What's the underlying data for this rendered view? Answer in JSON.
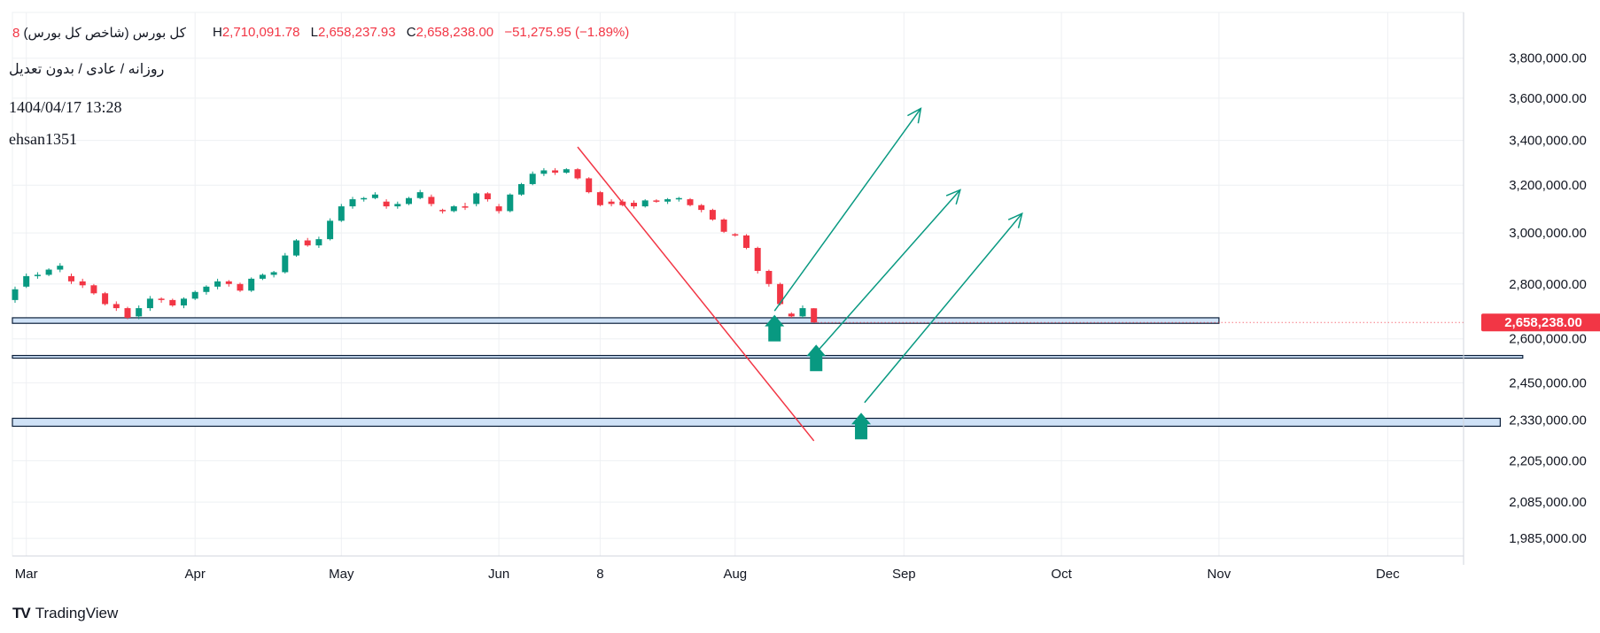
{
  "header": {
    "symbol": "کل بورس (شاخص کل بورس)",
    "suffix": "8",
    "high_label": "H",
    "high": "2,710,091.78",
    "low_label": "L",
    "low": "2,658,237.93",
    "close_label": "C",
    "close": "2,658,238.00",
    "change": "−51,275.95 (−1.89%)",
    "subtitle": "روزانه / عادی / بدون تعدیل",
    "timestamp": "1404/04/17 13:28",
    "author": "ehsan1351"
  },
  "brand": {
    "logo_text": "TV",
    "name": "TradingView"
  },
  "colors": {
    "up": "#089981",
    "down": "#f23645",
    "trendline": "#f23645",
    "projection": "#089981",
    "zone_fill": "#cfe2f7",
    "zone_border": "#0b1f3a",
    "grid": "#eef0f3",
    "price_tag": "#f23645"
  },
  "chart_data": {
    "type": "candlestick",
    "title": "کل بورس (شاخص کل بورس)",
    "y_scale": "log",
    "ylim": [
      1950000,
      3900000
    ],
    "grid": true,
    "y_ticks": [
      "3,800,000.00",
      "3,600,000.00",
      "3,400,000.00",
      "3,200,000.00",
      "3,000,000.00",
      "2,800,000.00",
      "2,600,000.00",
      "2,450,000.00",
      "2,330,000.00",
      "2,205,000.00",
      "2,085,000.00",
      "1,985,000.00"
    ],
    "y_tick_values": [
      3800000,
      3600000,
      3400000,
      3200000,
      3000000,
      2800000,
      2600000,
      2450000,
      2330000,
      2205000,
      2085000,
      1985000
    ],
    "x_ticks": [
      {
        "label": "Mar",
        "bar": 1
      },
      {
        "label": "Apr",
        "bar": 16
      },
      {
        "label": "May",
        "bar": 29
      },
      {
        "label": "Jun",
        "bar": 43
      },
      {
        "label": "8",
        "bar": 52
      },
      {
        "label": "Aug",
        "bar": 64
      },
      {
        "label": "Sep",
        "bar": 79
      },
      {
        "label": "Oct",
        "bar": 93
      },
      {
        "label": "Nov",
        "bar": 107
      },
      {
        "label": "Dec",
        "bar": 122
      }
    ],
    "last_price": 2658238,
    "last_price_label": "2,658,238.00",
    "candles": [
      {
        "o": 2740000,
        "h": 2790000,
        "l": 2730000,
        "c": 2780000
      },
      {
        "o": 2790000,
        "h": 2840000,
        "l": 2785000,
        "c": 2830000
      },
      {
        "o": 2830000,
        "h": 2845000,
        "l": 2820000,
        "c": 2835000
      },
      {
        "o": 2835000,
        "h": 2860000,
        "l": 2830000,
        "c": 2855000
      },
      {
        "o": 2855000,
        "h": 2880000,
        "l": 2845000,
        "c": 2870000
      },
      {
        "o": 2830000,
        "h": 2840000,
        "l": 2800000,
        "c": 2810000
      },
      {
        "o": 2810000,
        "h": 2820000,
        "l": 2785000,
        "c": 2795000
      },
      {
        "o": 2795000,
        "h": 2800000,
        "l": 2760000,
        "c": 2765000
      },
      {
        "o": 2765000,
        "h": 2770000,
        "l": 2720000,
        "c": 2725000
      },
      {
        "o": 2725000,
        "h": 2735000,
        "l": 2700000,
        "c": 2710000
      },
      {
        "o": 2710000,
        "h": 2715000,
        "l": 2670000,
        "c": 2675000
      },
      {
        "o": 2680000,
        "h": 2720000,
        "l": 2670000,
        "c": 2710000
      },
      {
        "o": 2710000,
        "h": 2755000,
        "l": 2700000,
        "c": 2745000
      },
      {
        "o": 2745000,
        "h": 2750000,
        "l": 2730000,
        "c": 2740000
      },
      {
        "o": 2740000,
        "h": 2745000,
        "l": 2715000,
        "c": 2720000
      },
      {
        "o": 2720000,
        "h": 2750000,
        "l": 2710000,
        "c": 2745000
      },
      {
        "o": 2745000,
        "h": 2775000,
        "l": 2740000,
        "c": 2770000
      },
      {
        "o": 2770000,
        "h": 2795000,
        "l": 2760000,
        "c": 2790000
      },
      {
        "o": 2790000,
        "h": 2820000,
        "l": 2780000,
        "c": 2810000
      },
      {
        "o": 2810000,
        "h": 2815000,
        "l": 2790000,
        "c": 2800000
      },
      {
        "o": 2800000,
        "h": 2805000,
        "l": 2770000,
        "c": 2775000
      },
      {
        "o": 2775000,
        "h": 2825000,
        "l": 2770000,
        "c": 2820000
      },
      {
        "o": 2820000,
        "h": 2840000,
        "l": 2815000,
        "c": 2835000
      },
      {
        "o": 2835000,
        "h": 2850000,
        "l": 2825000,
        "c": 2845000
      },
      {
        "o": 2845000,
        "h": 2920000,
        "l": 2840000,
        "c": 2910000
      },
      {
        "o": 2910000,
        "h": 2975000,
        "l": 2905000,
        "c": 2970000
      },
      {
        "o": 2970000,
        "h": 2980000,
        "l": 2945000,
        "c": 2950000
      },
      {
        "o": 2950000,
        "h": 2985000,
        "l": 2940000,
        "c": 2975000
      },
      {
        "o": 2975000,
        "h": 3060000,
        "l": 2970000,
        "c": 3050000
      },
      {
        "o": 3050000,
        "h": 3120000,
        "l": 3045000,
        "c": 3110000
      },
      {
        "o": 3110000,
        "h": 3150000,
        "l": 3100000,
        "c": 3140000
      },
      {
        "o": 3140000,
        "h": 3150000,
        "l": 3130000,
        "c": 3145000
      },
      {
        "o": 3145000,
        "h": 3170000,
        "l": 3140000,
        "c": 3160000
      },
      {
        "o": 3130000,
        "h": 3140000,
        "l": 3100000,
        "c": 3110000
      },
      {
        "o": 3110000,
        "h": 3130000,
        "l": 3100000,
        "c": 3120000
      },
      {
        "o": 3120000,
        "h": 3150000,
        "l": 3115000,
        "c": 3145000
      },
      {
        "o": 3145000,
        "h": 3180000,
        "l": 3140000,
        "c": 3170000
      },
      {
        "o": 3150000,
        "h": 3160000,
        "l": 3110000,
        "c": 3120000
      },
      {
        "o": 3095000,
        "h": 3100000,
        "l": 3080000,
        "c": 3090000
      },
      {
        "o": 3090000,
        "h": 3115000,
        "l": 3085000,
        "c": 3110000
      },
      {
        "o": 3110000,
        "h": 3125000,
        "l": 3095000,
        "c": 3105000
      },
      {
        "o": 3120000,
        "h": 3170000,
        "l": 3110000,
        "c": 3165000
      },
      {
        "o": 3165000,
        "h": 3170000,
        "l": 3130000,
        "c": 3140000
      },
      {
        "o": 3110000,
        "h": 3120000,
        "l": 3080000,
        "c": 3090000
      },
      {
        "o": 3090000,
        "h": 3165000,
        "l": 3085000,
        "c": 3160000
      },
      {
        "o": 3160000,
        "h": 3210000,
        "l": 3155000,
        "c": 3205000
      },
      {
        "o": 3205000,
        "h": 3260000,
        "l": 3200000,
        "c": 3250000
      },
      {
        "o": 3250000,
        "h": 3275000,
        "l": 3240000,
        "c": 3265000
      },
      {
        "o": 3265000,
        "h": 3275000,
        "l": 3245000,
        "c": 3255000
      },
      {
        "o": 3255000,
        "h": 3275000,
        "l": 3250000,
        "c": 3270000
      },
      {
        "o": 3270000,
        "h": 3275000,
        "l": 3225000,
        "c": 3230000
      },
      {
        "o": 3230000,
        "h": 3235000,
        "l": 3165000,
        "c": 3170000
      },
      {
        "o": 3170000,
        "h": 3175000,
        "l": 3110000,
        "c": 3115000
      },
      {
        "o": 3130000,
        "h": 3140000,
        "l": 3110000,
        "c": 3120000
      },
      {
        "o": 3130000,
        "h": 3140000,
        "l": 3110000,
        "c": 3115000
      },
      {
        "o": 3125000,
        "h": 3135000,
        "l": 3100000,
        "c": 3110000
      },
      {
        "o": 3110000,
        "h": 3140000,
        "l": 3105000,
        "c": 3135000
      },
      {
        "o": 3135000,
        "h": 3140000,
        "l": 3125000,
        "c": 3130000
      },
      {
        "o": 3130000,
        "h": 3145000,
        "l": 3120000,
        "c": 3140000
      },
      {
        "o": 3140000,
        "h": 3150000,
        "l": 3130000,
        "c": 3145000
      },
      {
        "o": 3140000,
        "h": 3145000,
        "l": 3110000,
        "c": 3115000
      },
      {
        "o": 3115000,
        "h": 3120000,
        "l": 3085000,
        "c": 3095000
      },
      {
        "o": 3095000,
        "h": 3100000,
        "l": 3050000,
        "c": 3055000
      },
      {
        "o": 3055000,
        "h": 3060000,
        "l": 3000000,
        "c": 3005000
      },
      {
        "o": 2995000,
        "h": 3000000,
        "l": 2985000,
        "c": 2990000
      },
      {
        "o": 2990000,
        "h": 2995000,
        "l": 2935000,
        "c": 2940000
      },
      {
        "o": 2940000,
        "h": 2945000,
        "l": 2840000,
        "c": 2850000
      },
      {
        "o": 2850000,
        "h": 2855000,
        "l": 2790000,
        "c": 2800000
      },
      {
        "o": 2800000,
        "h": 2805000,
        "l": 2720000,
        "c": 2725000
      },
      {
        "o": 2690000,
        "h": 2695000,
        "l": 2675000,
        "c": 2680000
      },
      {
        "o": 2680000,
        "h": 2720000,
        "l": 2675000,
        "c": 2710000
      },
      {
        "o": 2709514,
        "h": 2710091,
        "l": 2658237,
        "c": 2658238
      }
    ],
    "zones": [
      {
        "low": 2655000,
        "high": 2675000,
        "end_bar": 107
      },
      {
        "low": 2535000,
        "high": 2542000,
        "end_bar": 134
      },
      {
        "low": 2310000,
        "high": 2335000,
        "end_bar": 132
      }
    ],
    "trendline": {
      "from": {
        "bar": 50,
        "value": 3370000
      },
      "to": {
        "bar": 71,
        "value": 2265000
      }
    },
    "projections": [
      {
        "from": {
          "bar": 67.5,
          "value": 2700000
        },
        "to": {
          "bar": 80.5,
          "value": 3550000
        }
      },
      {
        "from": {
          "bar": 71.5,
          "value": 2565000
        },
        "to": {
          "bar": 84,
          "value": 3180000
        }
      },
      {
        "from": {
          "bar": 75.5,
          "value": 2385000
        },
        "to": {
          "bar": 89.5,
          "value": 3080000
        }
      }
    ],
    "markers": [
      {
        "bar": 67.5,
        "value": 2660000
      },
      {
        "bar": 71.2,
        "value": 2555000
      },
      {
        "bar": 75.2,
        "value": 2330000
      }
    ]
  }
}
